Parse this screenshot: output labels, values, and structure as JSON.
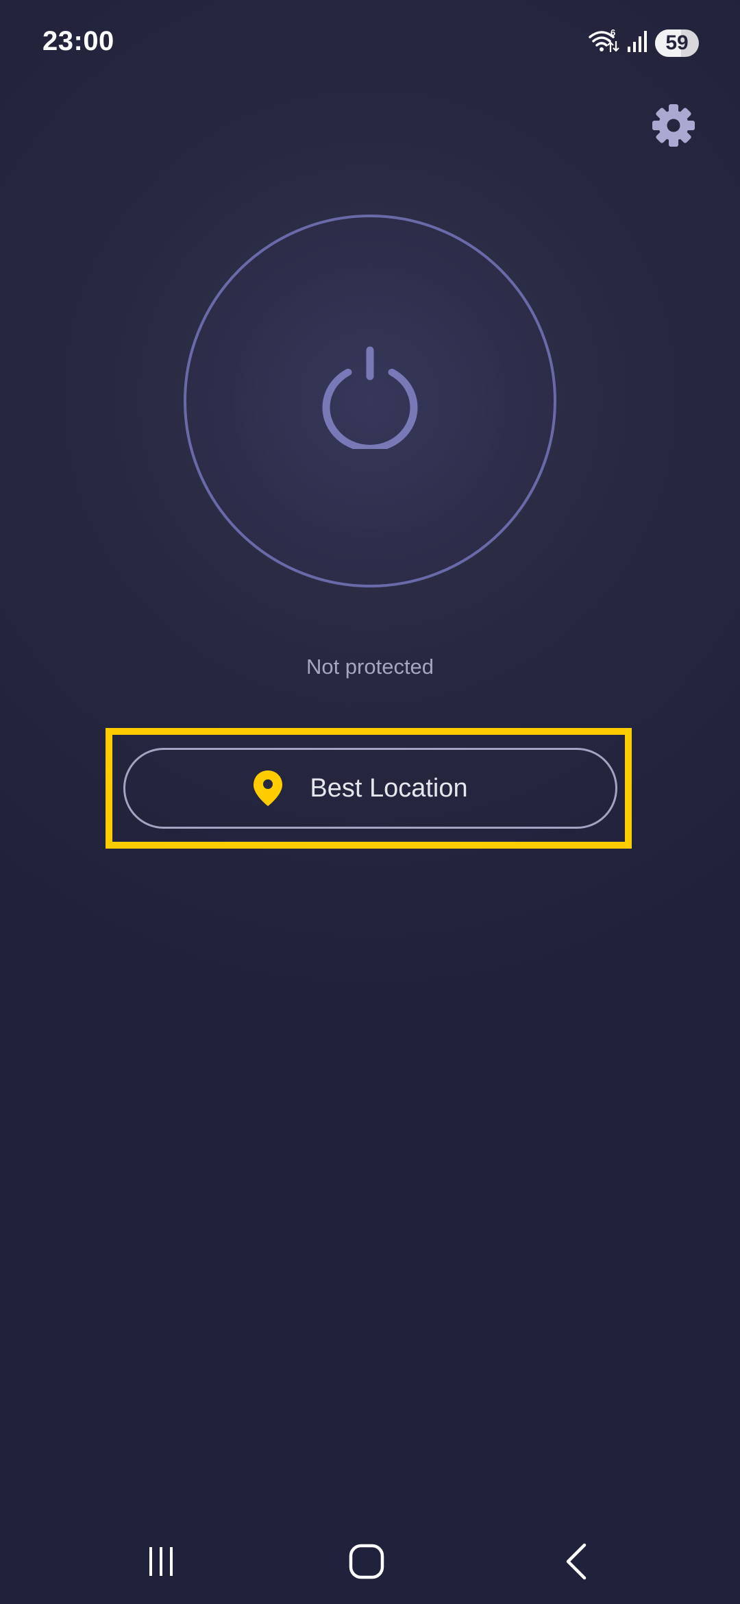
{
  "status_bar": {
    "time": "23:00",
    "battery_level": "59",
    "battery_fraction": 0.59
  },
  "header": {
    "settings_icon": "gear-icon"
  },
  "main": {
    "power_icon": "power-icon",
    "connection_status": "Not protected",
    "location_button": {
      "label": "Best Location",
      "icon": "location-pin-icon"
    }
  },
  "nav": {
    "recents_icon": "recents-icon",
    "home_icon": "home-icon",
    "back_icon": "back-icon"
  },
  "colors": {
    "background": "#22233a",
    "accent_ring": "#6b6aa9",
    "pin": "#ffcc00",
    "highlight": "#ffcc00",
    "gear": "#a9a9d2"
  }
}
